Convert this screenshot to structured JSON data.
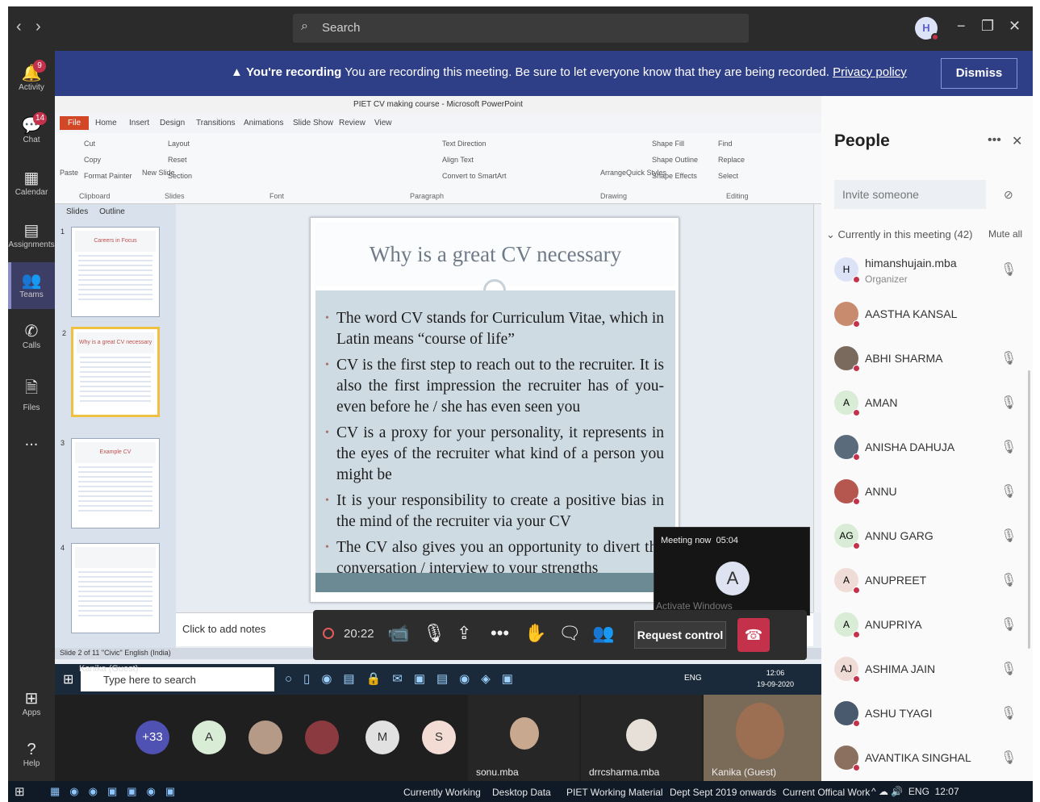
{
  "titlebar": {
    "search_placeholder": "Search",
    "avatar_initial": "H"
  },
  "rail": {
    "items": [
      {
        "label": "Activity",
        "badge": "9"
      },
      {
        "label": "Chat",
        "badge": "14"
      },
      {
        "label": "Calendar"
      },
      {
        "label": "Assignments"
      },
      {
        "label": "Teams"
      },
      {
        "label": "Calls"
      },
      {
        "label": "Files"
      },
      {
        "label": "..."
      },
      {
        "label": "Apps"
      },
      {
        "label": "Help"
      }
    ]
  },
  "banner": {
    "title": "You're recording",
    "message": "You are recording this meeting. Be sure to let everyone know that they are being recorded.",
    "link": "Privacy policy",
    "dismiss": "Dismiss"
  },
  "ppt": {
    "window_title": "PIET CV making course - Microsoft PowerPoint",
    "tabs": [
      "File",
      "Home",
      "Insert",
      "Design",
      "Transitions",
      "Animations",
      "Slide Show",
      "Review",
      "View"
    ],
    "ribbon": {
      "clipboard": [
        "Cut",
        "Copy",
        "Format Painter",
        "Paste"
      ],
      "slides": [
        "Layout",
        "Reset",
        "Section",
        "New Slide"
      ],
      "groups": [
        "Clipboard",
        "Slides",
        "Font",
        "Paragraph",
        "Drawing",
        "Editing"
      ],
      "editing": [
        "Find",
        "Replace",
        "Select"
      ],
      "drawing": [
        "Shape Fill",
        "Shape Outline",
        "Shape Effects",
        "Arrange",
        "Quick Styles"
      ],
      "paragraph": [
        "Text Direction",
        "Align Text",
        "Convert to SmartArt"
      ]
    },
    "panel_tabs": [
      "Slides",
      "Outline"
    ],
    "thumbs": [
      {
        "num": "1",
        "title": "Careers in Focus"
      },
      {
        "num": "2",
        "title": "Why is a great CV necessary"
      },
      {
        "num": "3",
        "title": "Example CV"
      },
      {
        "num": "4",
        "title": ""
      }
    ],
    "slide_title": "Why is a great CV necessary",
    "bullets": [
      "The word CV stands for Curriculum Vitae, which in Latin means “course of life”",
      "CV is the first step to reach out to the recruiter. It is also the first impression the recruiter has of you- even before he / she has even seen you",
      "CV is a proxy for your personality, it represents in the eyes of the recruiter what kind of a person you might be",
      "It is your responsibility to create a positive bias in the mind of the recruiter via your CV",
      "The CV also gives you an opportunity to divert the conversation / interview to your strengths"
    ],
    "notes": "Click to add notes",
    "status": "Slide 2 of 11   \"Civic\"   English (India)"
  },
  "presenter_taskbar": {
    "search": "Type here to search",
    "presenter": "Kanika (Guest)",
    "lang": "ENG",
    "time": "12:06",
    "date": "19-09-2020"
  },
  "controls": {
    "time": "20:22",
    "request_control": "Request control"
  },
  "meeting_now": {
    "title": "Meeting now",
    "time": "05:04",
    "initial": "A",
    "watermark": "Activate Windows"
  },
  "strip": {
    "overflow": "+33",
    "circles": [
      "A",
      "M",
      "S"
    ],
    "tiles": [
      {
        "name": "sonu.mba"
      },
      {
        "name": "drrcsharma.mba"
      },
      {
        "name": "Kanika (Guest)"
      }
    ]
  },
  "people": {
    "title": "People",
    "invite_placeholder": "Invite someone",
    "section": "Currently in this meeting (42)",
    "mute_all": "Mute all",
    "list": [
      {
        "name": "himanshujain.mba",
        "role": "Organizer",
        "initials": "H",
        "color": "#dde3f6"
      },
      {
        "name": "AASTHA KANSAL",
        "initials": "",
        "color": "#c98b6e"
      },
      {
        "name": "ABHI SHARMA",
        "initials": "",
        "color": "#7a6a5e"
      },
      {
        "name": "AMAN",
        "initials": "A",
        "color": "#d8ecd6"
      },
      {
        "name": "ANISHA DAHUJA",
        "initials": "",
        "color": "#5a6b7c"
      },
      {
        "name": "ANNU",
        "initials": "",
        "color": "#b5564f"
      },
      {
        "name": "ANNU GARG",
        "initials": "AG",
        "color": "#d8ecd6"
      },
      {
        "name": "ANUPREET",
        "initials": "A",
        "color": "#f0dcd6"
      },
      {
        "name": "ANUPRIYA",
        "initials": "A",
        "color": "#d8ecd6"
      },
      {
        "name": "ASHIMA JAIN",
        "initials": "AJ",
        "color": "#f0dcd6"
      },
      {
        "name": "ASHU TYAGI",
        "initials": "",
        "color": "#4a5a6e"
      },
      {
        "name": "AVANTIKA SINGHAL",
        "initials": "",
        "color": "#8b7060"
      }
    ]
  },
  "bottombar": {
    "items": [
      "Currently Working",
      "Desktop Data",
      "PIET Working Material",
      "Dept Sept 2019 onwards",
      "Current Offical Work"
    ],
    "lang": "ENG",
    "time": "12:07"
  }
}
